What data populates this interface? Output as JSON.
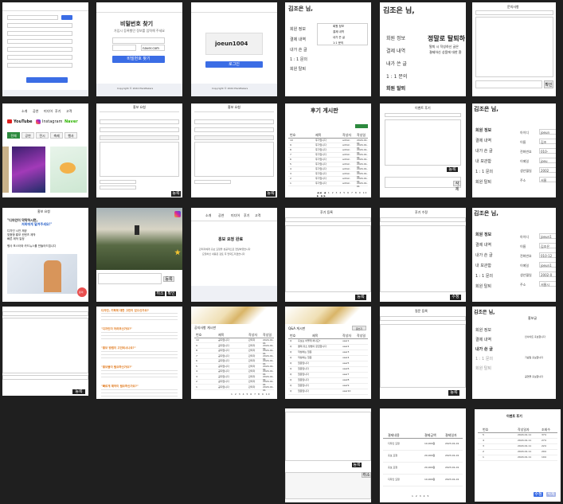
{
  "find_pw": {
    "title": "비밀번호 찾기",
    "subtitle": "가입시 등록했던 정보를 입력해 주세요",
    "name_value": "홍길동",
    "email_value": "ABCDE",
    "email_domain": "naver.com",
    "submit": "비밀번호 찾기",
    "footer": "Copyright © 2024 PlanMakers"
  },
  "found_id": {
    "id_value": "joeun1004",
    "submit": "로그인",
    "footer": "Copyright © 2024 PlanMakers"
  },
  "mypage_menu": {
    "greeting": "김조은 님,",
    "items": [
      "회원 정보",
      "결제 내역",
      "내가 쓴 글",
      "1 : 1 문의",
      "회원 탈퇴"
    ],
    "submenu": [
      "회원 정보",
      "결제 내역",
      "내가 쓴 글",
      "1:1 문의"
    ]
  },
  "withdraw": {
    "greeting": "김조은 님,",
    "items": [
      "회원 정보",
      "결제 내역",
      "내가 쓴 글",
      "1 : 1 문의",
      "회원 탈퇴"
    ],
    "headline": "정말로 탈퇴하",
    "desc1": "탈퇴 시 작성하신 글은",
    "desc2": "결제하신 상품에 대한 환"
  },
  "inquiry_tile": {
    "title": "문의사항",
    "cancel": "취소",
    "confirm": "확인"
  },
  "home": {
    "nav": [
      "소개",
      "공연",
      "미디어",
      "후기",
      "고객",
      "로그인"
    ],
    "brands": [
      "YouTube",
      "Instagram",
      "Naver"
    ],
    "tabs": [
      "전체",
      "공연",
      "전시",
      "축제",
      "행사"
    ]
  },
  "promo_req1": {
    "title": "홍보 요청",
    "submit": "등록"
  },
  "promo_req2": {
    "title": "홍보 요청",
    "submit": "등록"
  },
  "review_board": {
    "title": "후기 게시판",
    "write": "글쓰기",
    "cols": [
      "번호",
      "제목",
      "작성자",
      "작성일"
    ],
    "rows": [
      [
        "10",
        "후기입니다",
        "admin",
        "2024-01-01"
      ],
      [
        "9",
        "후기입니다",
        "admin",
        "2024-01-01"
      ],
      [
        "8",
        "후기입니다",
        "admin",
        "2024-01-01"
      ],
      [
        "7",
        "후기입니다",
        "admin",
        "2024-01-01"
      ],
      [
        "6",
        "후기입니다",
        "admin",
        "2024-01-01"
      ],
      [
        "5",
        "후기입니다",
        "admin",
        "2024-01-01"
      ],
      [
        "4",
        "후기입니다",
        "admin",
        "2024-01-01"
      ],
      [
        "3",
        "후기입니다",
        "admin",
        "2024-01-01"
      ],
      [
        "2",
        "후기입니다",
        "admin",
        "2024-01-01"
      ],
      [
        "1",
        "후기입니다",
        "admin",
        "2024-01-01"
      ]
    ],
    "pager": "◀◀ ◀ 1 2 3 4 5 6 7 8 9 10 ▶ ▶▶"
  },
  "event_review": {
    "title": "이벤트 후기",
    "submit": "등록",
    "delete": "삭제"
  },
  "profile": {
    "greeting": "김조은 님,",
    "items": [
      "회원 정보",
      "결제 내역",
      "내가 쓴 글",
      "내 보관함",
      "1 : 1 문의",
      "회원 탈퇴"
    ],
    "fields": [
      "아이디",
      "이름",
      "전화번호",
      "이메일",
      "생년월일",
      "주소"
    ],
    "values": [
      "joeun",
      "김조",
      "010-",
      "joeu",
      "2002",
      "서울"
    ]
  },
  "promo_example": {
    "title": "홍보 요청",
    "heading1": "\"디자인이 막막하시면,",
    "heading2": "저희에게 맡겨주세요!\"",
    "bullets": [
      "디자인 시안 제공",
      "맞춤형 홍보 컨텐츠 제작",
      "빠른 제작 일정"
    ],
    "note": "행사 포스터와 카드뉴스를 만들어드립니다",
    "badge": "문의"
  },
  "photo_tile": {
    "submit": "등록",
    "cancel": "취소",
    "confirm": "확인"
  },
  "promo_done": {
    "title": "홍보 요청 완료",
    "line1": "관리자에게 홍보 요청을 성공적으로 전달하였습니다",
    "line2": "요청하신 내용은 검토 후 연락드리겠습니다",
    "nav": [
      "소개",
      "공연",
      "미디어",
      "후기",
      "고객",
      "로그인"
    ]
  },
  "review_write": {
    "title": "후기 등록",
    "submit": "등록"
  },
  "review_edit": {
    "title": "후기 수정",
    "submit": "수정"
  },
  "profile2": {
    "greeting": "김조은 님,",
    "items": [
      "회원 정보",
      "결제 내역",
      "내가 쓴 글",
      "내 보관함",
      "1 : 1 문의",
      "회원 탈퇴"
    ],
    "fields": [
      "아이디",
      "이름",
      "전화번호",
      "이메일",
      "생년월일",
      "주소"
    ],
    "values": [
      "joeun1",
      "김조은",
      "010-12",
      "joeun1",
      "2002-0",
      "서울시"
    ]
  },
  "promo_text": {
    "heading": "디자인, 기획에 대한 고민이 있으신가요?",
    "h2": "\"디자인이 어려우신가요?\"",
    "h3": "\"홍보 방법이 고민되시나요?\"",
    "h4": "\"홍보물이 필요하신가요?\"",
    "h5": "\"빠르게 제작이 필요하신가요?\""
  },
  "notice_board": {
    "title": "공지사항 게시판",
    "cols": [
      "번호",
      "제목",
      "작성자",
      "작성일"
    ],
    "rows": [
      [
        "10",
        "공지입니다",
        "관리자",
        "2024-01-01"
      ],
      [
        "9",
        "공지입니다",
        "관리자",
        "2024-01-01"
      ],
      [
        "8",
        "공지입니다",
        "관리자",
        "2024-01-01"
      ],
      [
        "7",
        "공지입니다",
        "관리자",
        "2024-01-01"
      ],
      [
        "6",
        "공지입니다",
        "관리자",
        "2024-01-01"
      ],
      [
        "5",
        "공지입니다",
        "관리자",
        "2024-01-01"
      ],
      [
        "4",
        "공지입니다",
        "관리자",
        "2024-01-01"
      ],
      [
        "3",
        "공지입니다",
        "관리자",
        "2024-01-01"
      ],
      [
        "2",
        "공지입니다",
        "관리자",
        "2024-01-01"
      ],
      [
        "1",
        "공지입니다",
        "관리자",
        "2024-01-01"
      ]
    ],
    "pager": "1 2 3 4 5 6 7 8 9 10"
  },
  "qa_board": {
    "title": "Q&A 게시판",
    "write": "글쓰기",
    "cols": [
      "번호",
      "제목",
      "작성자",
      "작성일"
    ],
    "rows": [
      [
        "Q",
        "홍보는 어떻게 하나요?",
        "user1"
      ],
      [
        "Q",
        "결제 취소 방법이 궁금합니다",
        "user2"
      ],
      [
        "Q",
        "작성하는 질문",
        "user3"
      ],
      [
        "Q",
        "작성하는 질문",
        "user4"
      ],
      [
        "Q",
        "질문입니다",
        "user5"
      ],
      [
        "Q",
        "질문입니다",
        "user6"
      ],
      [
        "Q",
        "질문입니다",
        "user7"
      ],
      [
        "Q",
        "질문입니다",
        "user8"
      ],
      [
        "Q",
        "질문입니다",
        "user9"
      ],
      [
        "Q",
        "질문입니다",
        "user10"
      ]
    ]
  },
  "qa_write": {
    "title": "질문 등록",
    "submit": "등록"
  },
  "post_list": {
    "greeting": "김조은 님,",
    "items": [
      "회원 정보",
      "결제 내역",
      "내가 쓴 글",
      "1 : 1 문의",
      "회원 탈퇴"
    ],
    "title": "홍보글",
    "rows": [
      "인사이트 홍보합니다",
      "기념일 홍보합니다",
      "공연을 홍보합니다"
    ]
  },
  "reply_tile": {
    "submit": "등록",
    "cancel": "취소"
  },
  "payments": {
    "cols": [
      "결제내용",
      "결제금액",
      "결제일자"
    ],
    "rows": [
      [
        "디자인 요청",
        "10,000원",
        "2023-01-01"
      ],
      [
        "홍보 요청",
        "20,000원",
        "2023-01-01"
      ],
      [
        "홍보 요청",
        "20,000원",
        "2023-01-01"
      ],
      [
        "디자인 요청",
        "10,000원",
        "2023-01-01"
      ]
    ],
    "pager": "1 2 3 4 5"
  },
  "event_list": {
    "title": "이벤트 후기",
    "cols": [
      "번호",
      "작성일자",
      "조회수"
    ],
    "rows": [
      [
        "5",
        "2024.01.11",
        "374"
      ],
      [
        "4",
        "2024.01.11",
        "274"
      ],
      [
        "3",
        "2024.01.11",
        "224"
      ],
      [
        "2",
        "2024.01.11",
        "294"
      ],
      [
        "1",
        "2024.01.11",
        "194"
      ]
    ],
    "edit": "수정",
    "delete": "삭제"
  }
}
